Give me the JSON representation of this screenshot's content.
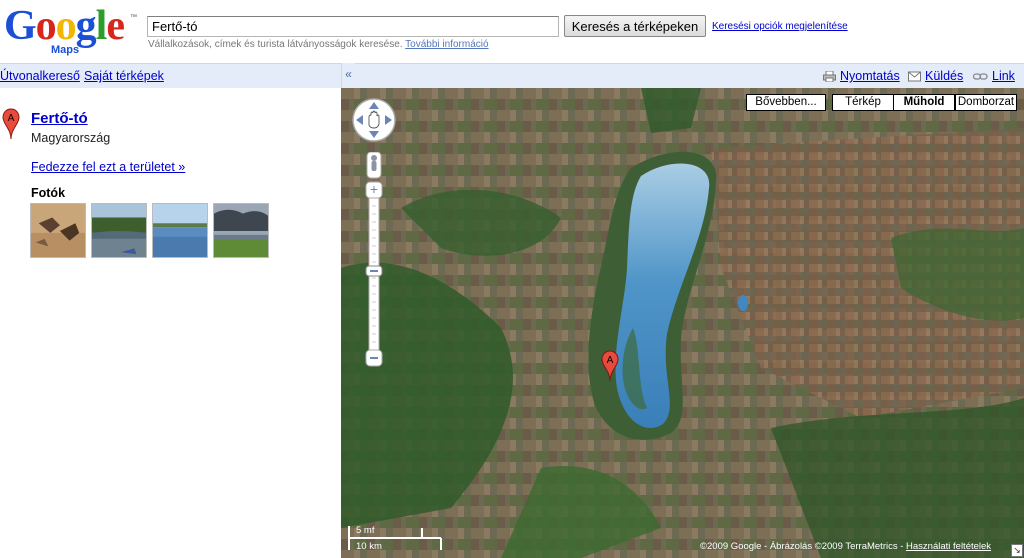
{
  "header": {
    "logo_text": "Google",
    "logo_tm": "™",
    "logo_sub": "Maps",
    "search_value": "Fertő-tó",
    "search_button": "Keresés a térképeken",
    "search_options_link": "Keresési opciók megjelenítése",
    "hint_text": "Vállalkozások, címek és turista látványosságok keresése.",
    "hint_link": "További információ"
  },
  "toolbar": {
    "collapse_icon": "«",
    "left_links": [
      "Útvonalkereső",
      "Saját térképek"
    ],
    "print": "Nyomtatás",
    "send": "Küldés",
    "link": "Link"
  },
  "sidebar": {
    "result_marker": "A",
    "title": "Fertő-tó",
    "country": "Magyarország",
    "explore_link": "Fedezze fel ezt a területet »",
    "photos_heading": "Fotók"
  },
  "map": {
    "type_buttons": [
      "Bővebben...",
      "Térkép",
      "Műhold",
      "Domborzat"
    ],
    "active_type": "Műhold",
    "pin_label": "A",
    "scale_miles": "5 mf",
    "scale_km": "10 km",
    "copyright": "©2009 Google - Ábrázolás ©2009 TerraMetrics - ",
    "terms_link": "Használati feltételek"
  },
  "colors": {
    "link": "#0000cc",
    "toolbar_bg": "#e5ecf9",
    "marker": "#e84a3c"
  }
}
